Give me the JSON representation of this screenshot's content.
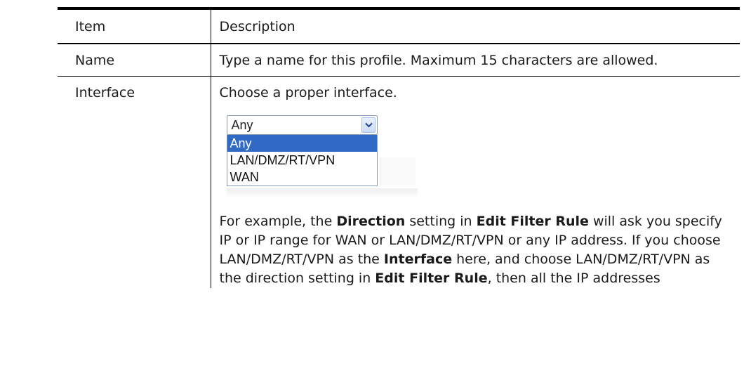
{
  "table": {
    "header": {
      "item": "Item",
      "description": "Description"
    },
    "rows": [
      {
        "item": "Name",
        "description": "Type a name for this profile. Maximum 15 characters are allowed."
      },
      {
        "item": "Interface",
        "intro": "Choose a proper interface.",
        "dropdown": {
          "selected": "Any",
          "options": [
            "Any",
            "LAN/DMZ/RT/VPN",
            "WAN"
          ],
          "highlighted_option": "Any",
          "highlight_color": "#316ac5"
        },
        "example": {
          "t1": "For example, the ",
          "b1": "Direction",
          "t2": " setting in ",
          "b2": "Edit Filter Rule",
          "t3": " will ask you specify IP or IP range for WAN or LAN/DMZ/RT/VPN or any IP address. If you choose LAN/DMZ/RT/VPN as the ",
          "b3": "Interface",
          "t4": " here, and choose LAN/DMZ/RT/VPN as the direction setting in ",
          "b4": "Edit Filter Rule",
          "t5": ", then all the IP addresses"
        }
      }
    ]
  }
}
